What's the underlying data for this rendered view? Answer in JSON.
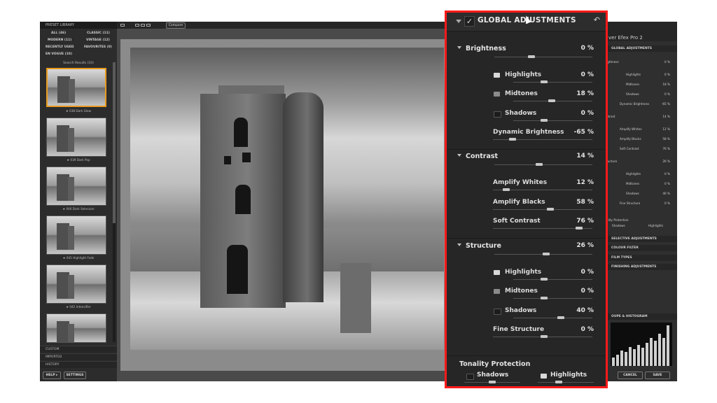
{
  "preset_library": {
    "title": "PRESET LIBRARY",
    "categories": [
      {
        "label": "ALL (46)"
      },
      {
        "label": "CLASSIC (11)"
      },
      {
        "label": "MODERN (11)"
      },
      {
        "label": "VINTAGE (12)"
      },
      {
        "label": "RECENTLY USED"
      },
      {
        "label": "FAVOURITES (0)"
      },
      {
        "label": "EN VOGUE (10)"
      }
    ],
    "search_results": "Search Results (10)",
    "presets": [
      {
        "label": "★ 038 Dark Glow",
        "selected": true
      },
      {
        "label": "★ 039 Dark Pop",
        "selected": false
      },
      {
        "label": "★ 040 Dark Selenium",
        "selected": false
      },
      {
        "label": "★ 041 Highlight Fade",
        "selected": false
      },
      {
        "label": "★ 042 Intensifier",
        "selected": false
      },
      {
        "label": "",
        "selected": false
      }
    ],
    "footer": {
      "custom": "CUSTOM",
      "imported": "IMPORTED",
      "history": "HISTORY"
    },
    "buttons": {
      "help": "HELP ▸",
      "settings": "SETTINGS"
    }
  },
  "toolbar": {
    "compare": "Compare"
  },
  "right_panel": {
    "title": "ver Efex Pro 2",
    "sections": {
      "global": "GLOBAL ADJUSTMENTS",
      "selective": "SELECTIVE ADJUSTMENTS",
      "colour": "COLOUR FILTER",
      "film": "FILM TYPES",
      "finishing": "FINISHING ADJUSTMENTS",
      "loupe": "OUPE & HISTOGRAM"
    },
    "rows": [
      {
        "label": "ightness",
        "value": "0 %"
      },
      {
        "label": "Highlights",
        "value": "0 %"
      },
      {
        "label": "Midtones",
        "value": "18 %"
      },
      {
        "label": "Shadows",
        "value": "0 %"
      },
      {
        "label": "Dynamic Brightness",
        "value": "-65 %"
      },
      {
        "label": "ntrast",
        "value": "14 %"
      },
      {
        "label": "Amplify Whites",
        "value": "12 %"
      },
      {
        "label": "Amplify Blacks",
        "value": "58 %"
      },
      {
        "label": "Soft Contrast",
        "value": "76 %"
      },
      {
        "label": "ructure",
        "value": "26 %"
      },
      {
        "label": "Highlights",
        "value": "0 %"
      },
      {
        "label": "Midtones",
        "value": "0 %"
      },
      {
        "label": "Shadows",
        "value": "40 %"
      },
      {
        "label": "Fine Structure",
        "value": "0 %"
      }
    ],
    "tonality": {
      "title": "ality Protection",
      "shadows": "Shadows",
      "highlights": "Highlights"
    },
    "buttons": {
      "cancel": "CANCEL",
      "save": "SAVE"
    }
  },
  "global_panel": {
    "title": "GLOBAL ADJUSTMENTS",
    "check": "✓",
    "undo": "↶",
    "groups": [
      {
        "label": "Brightness",
        "value": "0 %",
        "level": 0.5,
        "items": [
          {
            "label": "Highlights",
            "value": "0 %",
            "level": 0.5,
            "swatch": "#d8d8d8"
          },
          {
            "label": "Midtones",
            "value": "18 %",
            "level": 0.59,
            "swatch": "#8a8a8a"
          },
          {
            "label": "Shadows",
            "value": "0 %",
            "level": 0.5,
            "swatch": "#1c1c1c"
          },
          {
            "label": "Dynamic Brightness",
            "value": "-65 %",
            "level": 0.18,
            "swatch": ""
          }
        ]
      },
      {
        "label": "Contrast",
        "value": "14 %",
        "level": 0.57,
        "items": [
          {
            "label": "Amplify Whites",
            "value": "12 %",
            "level": 0.12,
            "swatch": ""
          },
          {
            "label": "Amplify Blacks",
            "value": "58 %",
            "level": 0.58,
            "swatch": ""
          },
          {
            "label": "Soft Contrast",
            "value": "76 %",
            "level": 0.76,
            "swatch": ""
          }
        ]
      },
      {
        "label": "Structure",
        "value": "26 %",
        "level": 0.63,
        "items": [
          {
            "label": "Highlights",
            "value": "0 %",
            "level": 0.5,
            "swatch": "#d8d8d8"
          },
          {
            "label": "Midtones",
            "value": "0 %",
            "level": 0.5,
            "swatch": "#8a8a8a"
          },
          {
            "label": "Shadows",
            "value": "40 %",
            "level": 0.7,
            "swatch": "#1c1c1c"
          },
          {
            "label": "Fine Structure",
            "value": "0 %",
            "level": 0.5,
            "swatch": ""
          }
        ]
      }
    ],
    "tonality": {
      "title": "Tonality Protection",
      "shadows": "Shadows",
      "highlights": "Highlights",
      "shadows_level": 0.3,
      "highlights_level": 0.3
    }
  }
}
